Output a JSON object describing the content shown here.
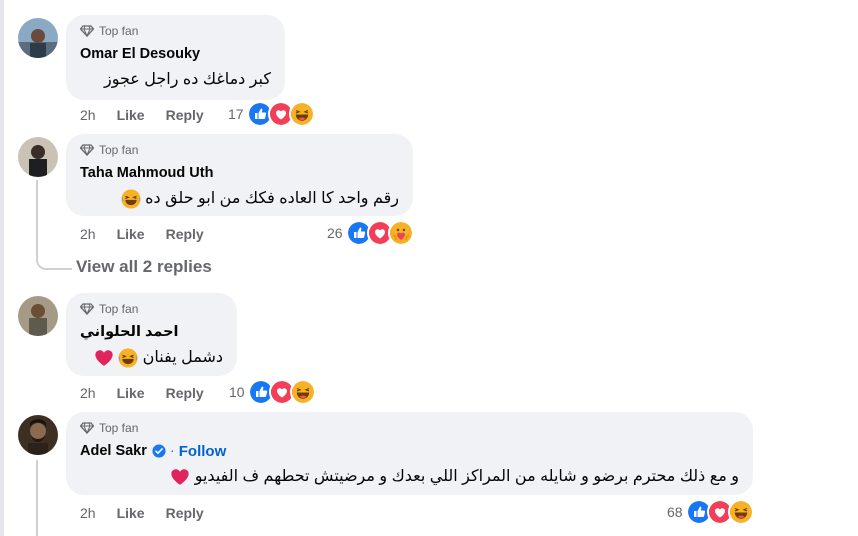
{
  "colors": {
    "bubble": "#f0f2f5",
    "secondary_text": "#65676b",
    "link_blue": "#0064d1",
    "like_blue": "#1877f2",
    "love_red": "#f33e58",
    "haha_yellow": "#f7b125"
  },
  "comments": [
    {
      "badge": "Top fan",
      "name": "Omar El Desouky",
      "text": "كبر دماغك ده راجل عجوز",
      "time": "2h",
      "like": "Like",
      "reply": "Reply",
      "reaction_count": "17",
      "reactions": [
        "like",
        "love",
        "haha"
      ]
    },
    {
      "badge": "Top fan",
      "name": "Taha Mahmoud Uth",
      "text": "رقم واحد كا العاده فكك من ابو حلق ده",
      "time": "2h",
      "like": "Like",
      "reply": "Reply",
      "reaction_count": "26",
      "reactions": [
        "like",
        "love",
        "care"
      ]
    },
    {
      "badge": "Top fan",
      "name": "احمد الحلواني",
      "text": "دشمل يفنان",
      "time": "2h",
      "like": "Like",
      "reply": "Reply",
      "reaction_count": "10",
      "reactions": [
        "like",
        "love",
        "haha"
      ]
    },
    {
      "badge": "Top fan",
      "name": "Adel Sakr",
      "follow": "Follow",
      "separator": "·",
      "text": "و مع ذلك محترم برضو و شايله من المراكز اللي بعدك و مرضيتش تحطهم ف الفيديو",
      "time": "2h",
      "like": "Like",
      "reply": "Reply",
      "reaction_count": "68",
      "reactions": [
        "like",
        "love",
        "haha"
      ]
    }
  ],
  "view_replies": "View all 2 replies"
}
